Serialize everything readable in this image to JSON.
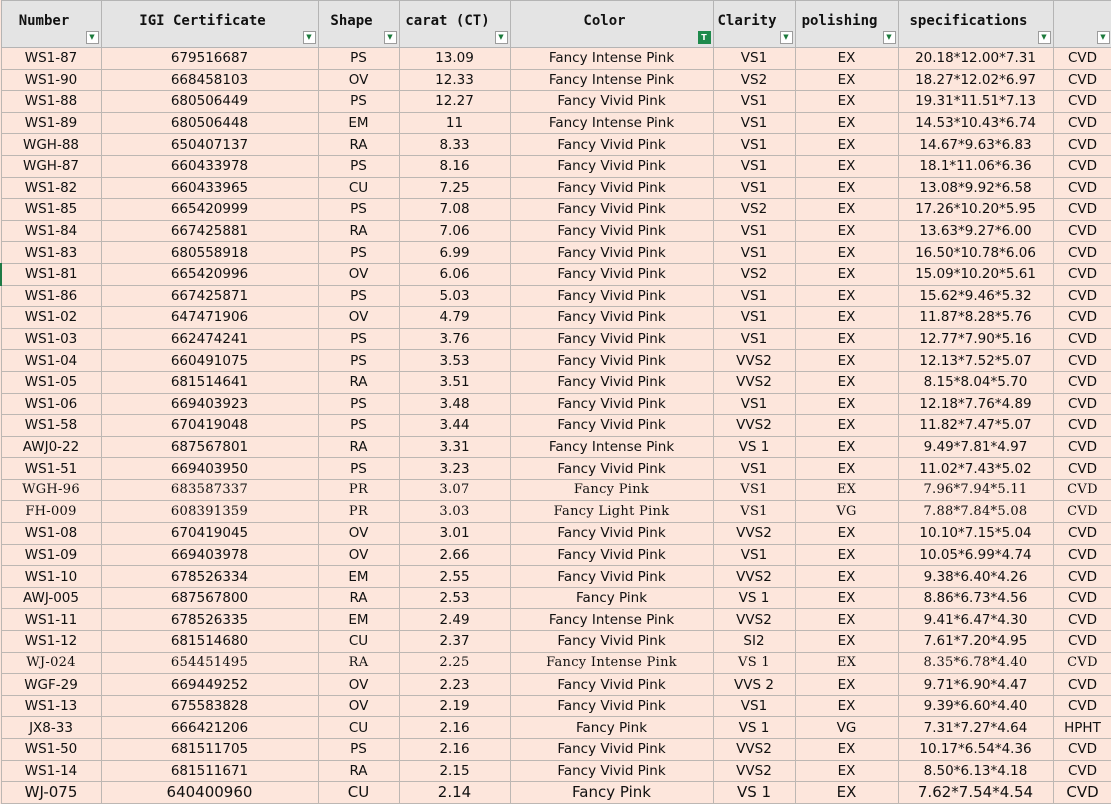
{
  "headers": [
    {
      "label": "Number",
      "filter": "▼",
      "active": false
    },
    {
      "label": "IGI Certificate",
      "filter": "▼",
      "active": false
    },
    {
      "label": "Shape",
      "filter": "▼",
      "active": false
    },
    {
      "label": "carat (CT)",
      "filter": "▼",
      "active": false
    },
    {
      "label": "Color",
      "filter": "T",
      "active": true
    },
    {
      "label": "Clarity",
      "filter": "▼",
      "active": false
    },
    {
      "label": "polishing",
      "filter": "▼",
      "active": false
    },
    {
      "label": "specifications",
      "filter": "▼",
      "active": false
    },
    {
      "label": "",
      "filter": "▼",
      "active": false
    }
  ],
  "rows": [
    [
      "WS1-87",
      "679516687",
      "PS",
      "13.09",
      "Fancy Intense Pink",
      "VS1",
      "EX",
      "20.18*12.00*7.31",
      "CVD"
    ],
    [
      "WS1-90",
      "668458103",
      "OV",
      "12.33",
      "Fancy Intense Pink",
      "VS2",
      "EX",
      "18.27*12.02*6.97",
      "CVD"
    ],
    [
      "WS1-88",
      "680506449",
      "PS",
      "12.27",
      "Fancy Vivid Pink",
      "VS1",
      "EX",
      "19.31*11.51*7.13",
      "CVD"
    ],
    [
      "WS1-89",
      "680506448",
      "EM",
      "11",
      "Fancy Intense Pink",
      "VS1",
      "EX",
      "14.53*10.43*6.74",
      "CVD"
    ],
    [
      "WGH-88",
      "650407137",
      "RA",
      "8.33",
      "Fancy Vivid Pink",
      "VS1",
      "EX",
      "14.67*9.63*6.83",
      "CVD"
    ],
    [
      "WGH-87",
      "660433978",
      "PS",
      "8.16",
      "Fancy Vivid Pink",
      "VS1",
      "EX",
      "18.1*11.06*6.36",
      "CVD"
    ],
    [
      "WS1-82",
      "660433965",
      "CU",
      "7.25",
      "Fancy Vivid Pink",
      "VS1",
      "EX",
      "13.08*9.92*6.58",
      "CVD"
    ],
    [
      "WS1-85",
      "665420999",
      "PS",
      "7.08",
      "Fancy Vivid Pink",
      "VS2",
      "EX",
      "17.26*10.20*5.95",
      "CVD"
    ],
    [
      "WS1-84",
      "667425881",
      "RA",
      "7.06",
      "Fancy Vivid Pink",
      "VS1",
      "EX",
      "13.63*9.27*6.00",
      "CVD"
    ],
    [
      "WS1-83",
      "680558918",
      "PS",
      "6.99",
      "Fancy Vivid Pink",
      "VS1",
      "EX",
      "16.50*10.78*6.06",
      "CVD"
    ],
    [
      "WS1-81",
      "665420996",
      "OV",
      "6.06",
      "Fancy Vivid Pink",
      "VS2",
      "EX",
      "15.09*10.20*5.61",
      "CVD"
    ],
    [
      "WS1-86",
      "667425871",
      "PS",
      "5.03",
      "Fancy Vivid Pink",
      "VS1",
      "EX",
      "15.62*9.46*5.32",
      "CVD"
    ],
    [
      "WS1-02",
      "647471906",
      "OV",
      "4.79",
      "Fancy Vivid Pink",
      "VS1",
      "EX",
      "11.87*8.28*5.76",
      "CVD"
    ],
    [
      "WS1-03",
      "662474241",
      "PS",
      "3.76",
      "Fancy Vivid Pink",
      "VS1",
      "EX",
      "12.77*7.90*5.16",
      "CVD"
    ],
    [
      "WS1-04",
      "660491075",
      "PS",
      "3.53",
      "Fancy Vivid Pink",
      "VVS2",
      "EX",
      "12.13*7.52*5.07",
      "CVD"
    ],
    [
      "WS1-05",
      "681514641",
      "RA",
      "3.51",
      "Fancy Vivid Pink",
      "VVS2",
      "EX",
      "8.15*8.04*5.70",
      "CVD"
    ],
    [
      "WS1-06",
      "669403923",
      "PS",
      "3.48",
      "Fancy Vivid Pink",
      "VS1",
      "EX",
      "12.18*7.76*4.89",
      "CVD"
    ],
    [
      "WS1-58",
      "670419048",
      "PS",
      "3.44",
      "Fancy Vivid Pink",
      "VVS2",
      "EX",
      "11.82*7.47*5.07",
      "CVD"
    ],
    [
      "AWJ0-22",
      "687567801",
      "RA",
      "3.31",
      "Fancy Intense Pink",
      "VS 1",
      "EX",
      "9.49*7.81*4.97",
      "CVD"
    ],
    [
      "WS1-51",
      "669403950",
      "PS",
      "3.23",
      "Fancy Vivid Pink",
      "VS1",
      "EX",
      "11.02*7.43*5.02",
      "CVD"
    ],
    [
      "WGH-96",
      "683587337",
      "PR",
      "3.07",
      "Fancy  Pink",
      "VS1",
      "EX",
      "7.96*7.94*5.11",
      "CVD"
    ],
    [
      "FH-009",
      "608391359",
      "PR",
      "3.03",
      "Fancy Light Pink",
      "VS1",
      "VG",
      "7.88*7.84*5.08",
      "CVD"
    ],
    [
      "WS1-08",
      "670419045",
      "OV",
      "3.01",
      "Fancy Vivid Pink",
      "VVS2",
      "EX",
      "10.10*7.15*5.04",
      "CVD"
    ],
    [
      "WS1-09",
      "669403978",
      "OV",
      "2.66",
      "Fancy Vivid Pink",
      "VS1",
      "EX",
      "10.05*6.99*4.74",
      "CVD"
    ],
    [
      "WS1-10",
      "678526334",
      "EM",
      "2.55",
      "Fancy Vivid Pink",
      "VVS2",
      "EX",
      "9.38*6.40*4.26",
      "CVD"
    ],
    [
      "AWJ-005",
      "687567800",
      "RA",
      "2.53",
      "Fancy Pink",
      "VS 1",
      "EX",
      "8.86*6.73*4.56",
      "CVD"
    ],
    [
      "WS1-11",
      "678526335",
      "EM",
      "2.49",
      "Fancy Intense Pink",
      "VVS2",
      "EX",
      "9.41*6.47*4.30",
      "CVD"
    ],
    [
      "WS1-12",
      "681514680",
      "CU",
      "2.37",
      "Fancy Vivid Pink",
      "SI2",
      "EX",
      "7.61*7.20*4.95",
      "CVD"
    ],
    [
      "WJ-024",
      "654451495",
      "RA",
      "2.25",
      "Fancy Intense Pink",
      "VS 1",
      "EX",
      "8.35*6.78*4.40",
      "CVD"
    ],
    [
      "WGF-29",
      "669449252",
      "OV",
      "2.23",
      "Fancy Vivid Pink",
      "VVS 2",
      "EX",
      "9.71*6.90*4.47",
      "CVD"
    ],
    [
      "WS1-13",
      "675583828",
      "OV",
      "2.19",
      "Fancy Vivid Pink",
      "VS1",
      "EX",
      "9.39*6.60*4.40",
      "CVD"
    ],
    [
      "JX8-33",
      "666421206",
      "CU",
      "2.16",
      "Fancy Pink",
      "VS 1",
      "VG",
      "7.31*7.27*4.64",
      "HPHT"
    ],
    [
      "WS1-50",
      "681511705",
      "PS",
      "2.16",
      "Fancy Vivid Pink",
      "VVS2",
      "EX",
      "10.17*6.54*4.36",
      "CVD"
    ],
    [
      "WS1-14",
      "681511671",
      "RA",
      "2.15",
      "Fancy Vivid Pink",
      "VVS2",
      "EX",
      "8.50*6.13*4.18",
      "CVD"
    ],
    [
      "WJ-075",
      "640400960",
      "CU",
      "2.14",
      "Fancy Pink",
      "VS 1",
      "EX",
      "7.62*7.54*4.54",
      "CVD"
    ]
  ],
  "row_styles": {
    "20": "mono",
    "21": "mono",
    "28": "mono",
    "34": "big"
  },
  "selected_row_index": 10,
  "colors": {
    "row_fill": "#fde6dc",
    "header_fill": "#e4e4e4",
    "grid": "#bdb7b3",
    "filter_active": "#1e8a4c"
  }
}
